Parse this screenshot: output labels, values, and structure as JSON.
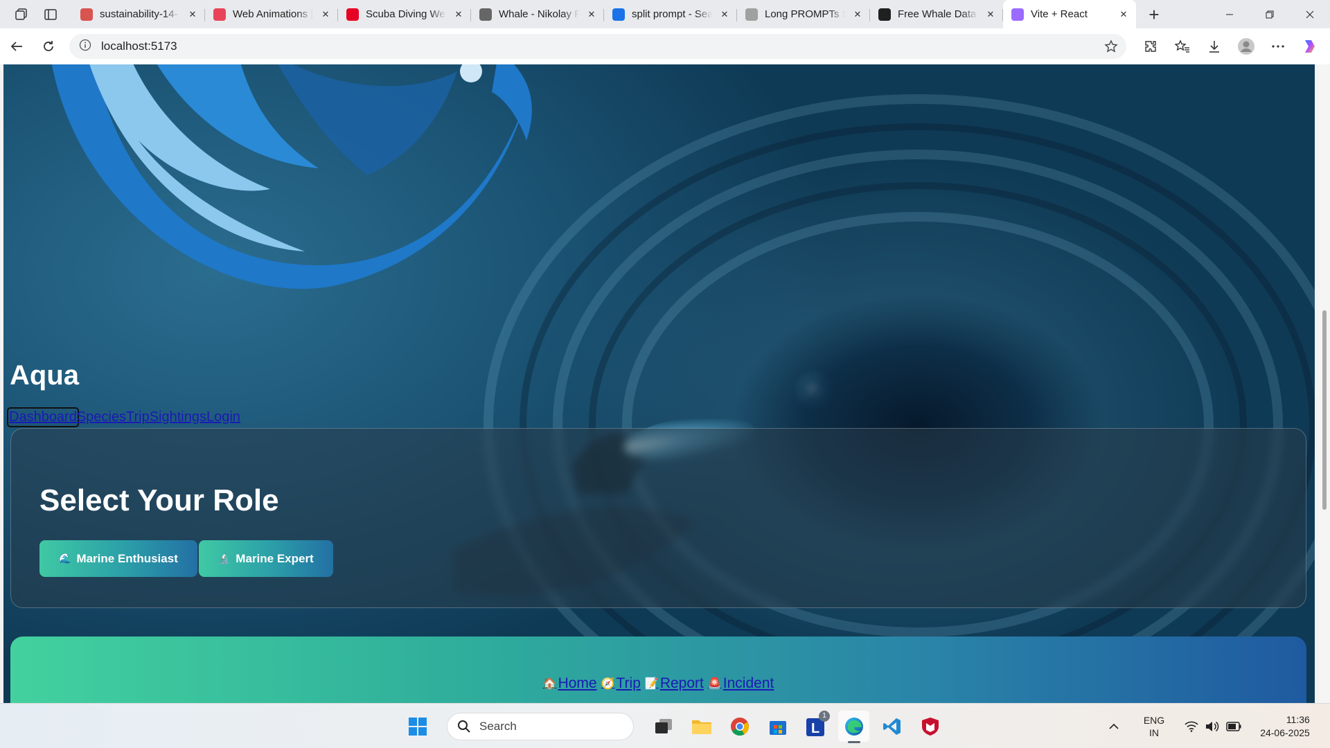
{
  "browser": {
    "tabs": [
      {
        "title": "sustainability-14-",
        "favicon_color": "#d9534f",
        "active": false
      },
      {
        "title": "Web Animations | ",
        "favicon_color": "#e8455a",
        "active": false
      },
      {
        "title": "Scuba Diving Web",
        "favicon_color": "#e60023",
        "active": false
      },
      {
        "title": "Whale - Nikolay F",
        "favicon_color": "#666666",
        "active": false
      },
      {
        "title": "split prompt - Sea",
        "favicon_color": "#1a73e8",
        "active": false
      },
      {
        "title": "Long PROMPTs Sp",
        "favicon_color": "#a0a0a0",
        "active": false
      },
      {
        "title": "Free Whale Data",
        "favicon_color": "#202020",
        "active": false
      },
      {
        "title": "Vite + React",
        "favicon_color": "#9b6bff",
        "active": true
      }
    ],
    "new_tab_label": "+",
    "url": "localhost:5173"
  },
  "page": {
    "site_title": "Aqua",
    "nav_links": [
      "Dashboard",
      "Species",
      "Trip",
      "Sightings",
      "Login"
    ],
    "role_heading": "Select Your Role",
    "role_buttons": [
      {
        "icon": "🌊",
        "label": "Marine Enthusiast"
      },
      {
        "icon": "🔬",
        "label": "Marine Expert"
      }
    ],
    "bottom_links": [
      {
        "icon": "🏠",
        "label": "Home"
      },
      {
        "icon": "🧭",
        "label": "Trip"
      },
      {
        "icon": "📝",
        "label": "Report"
      },
      {
        "icon": "🚨",
        "label": "Incident"
      }
    ]
  },
  "taskbar": {
    "search_placeholder": "Search",
    "notification_badge": "1",
    "language": "ENG",
    "region": "IN",
    "time": "11:36",
    "date": "24-06-2025"
  }
}
